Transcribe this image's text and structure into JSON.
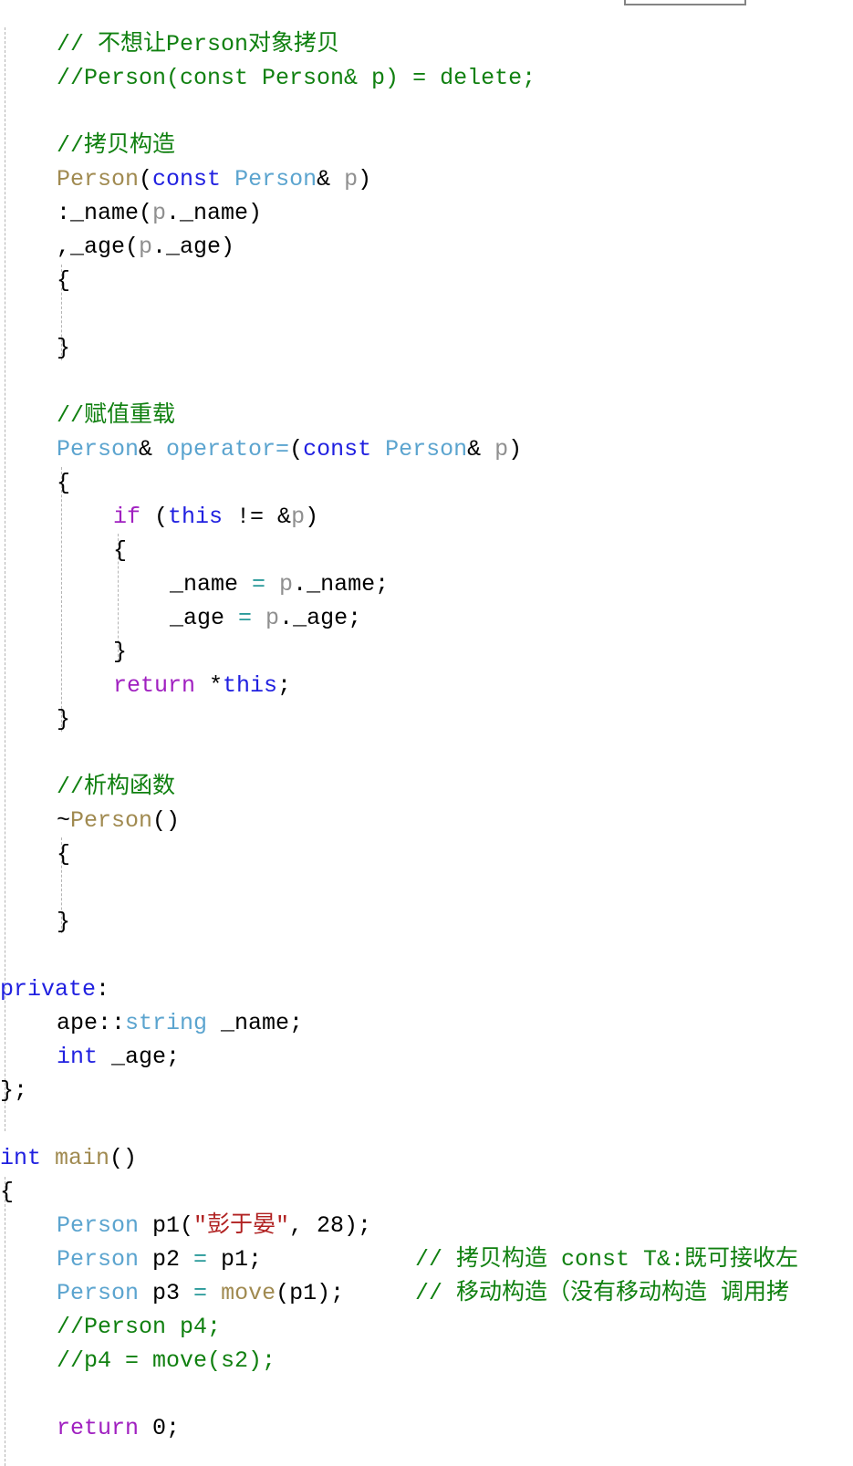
{
  "app": {
    "kind": "code-editor-viewport",
    "language": "C++",
    "background": "#ffffff"
  },
  "colors": {
    "comment": "#108010",
    "keyword": "#2020e0",
    "control_keyword": "#a020c0",
    "type": "#5ba4cf",
    "function": "#a08a50",
    "variable": "#909090",
    "string": "#b02020",
    "operator": "#2a9a9a",
    "plain": "#000000",
    "indent_guide": "#b4b4b4",
    "top_fragment_border": "#848484"
  },
  "top_fragment": {
    "name": "clipped-popup-box"
  },
  "code": {
    "lines": [
      {
        "indent": 1,
        "tokens": [
          {
            "t": "// 不想让Person对象拷贝",
            "c": "cmt"
          }
        ]
      },
      {
        "indent": 1,
        "tokens": [
          {
            "t": "//Person(const Person& p) = delete;",
            "c": "cmt"
          }
        ]
      },
      {
        "indent": 1,
        "tokens": []
      },
      {
        "indent": 1,
        "tokens": [
          {
            "t": "//拷贝构造",
            "c": "cmt"
          }
        ]
      },
      {
        "indent": 1,
        "tokens": [
          {
            "t": "Person",
            "c": "fn"
          },
          {
            "t": "(",
            "c": "pl"
          },
          {
            "t": "const",
            "c": "kw"
          },
          {
            "t": " ",
            "c": "pl"
          },
          {
            "t": "Person",
            "c": "type"
          },
          {
            "t": "& ",
            "c": "pl"
          },
          {
            "t": "p",
            "c": "var"
          },
          {
            "t": ")",
            "c": "pl"
          }
        ]
      },
      {
        "indent": 1,
        "tokens": [
          {
            "t": ":_name(",
            "c": "pl"
          },
          {
            "t": "p",
            "c": "var"
          },
          {
            "t": "._name)",
            "c": "pl"
          }
        ]
      },
      {
        "indent": 1,
        "tokens": [
          {
            "t": ",_age(",
            "c": "pl"
          },
          {
            "t": "p",
            "c": "var"
          },
          {
            "t": "._age)",
            "c": "pl"
          }
        ]
      },
      {
        "indent": 1,
        "tokens": [
          {
            "t": "{",
            "c": "pl"
          }
        ]
      },
      {
        "indent": 2,
        "tokens": []
      },
      {
        "indent": 1,
        "tokens": [
          {
            "t": "}",
            "c": "pl"
          }
        ]
      },
      {
        "indent": 1,
        "tokens": []
      },
      {
        "indent": 1,
        "tokens": [
          {
            "t": "//赋值重载",
            "c": "cmt"
          }
        ]
      },
      {
        "indent": 1,
        "tokens": [
          {
            "t": "Person",
            "c": "type"
          },
          {
            "t": "& ",
            "c": "pl"
          },
          {
            "t": "operator=",
            "c": "type"
          },
          {
            "t": "(",
            "c": "pl"
          },
          {
            "t": "const",
            "c": "kw"
          },
          {
            "t": " ",
            "c": "pl"
          },
          {
            "t": "Person",
            "c": "type"
          },
          {
            "t": "& ",
            "c": "pl"
          },
          {
            "t": "p",
            "c": "var"
          },
          {
            "t": ")",
            "c": "pl"
          }
        ]
      },
      {
        "indent": 1,
        "tokens": [
          {
            "t": "{",
            "c": "pl"
          }
        ]
      },
      {
        "indent": 2,
        "tokens": [
          {
            "t": "if",
            "c": "kwc"
          },
          {
            "t": " (",
            "c": "pl"
          },
          {
            "t": "this",
            "c": "kw"
          },
          {
            "t": " != &",
            "c": "pl"
          },
          {
            "t": "p",
            "c": "var"
          },
          {
            "t": ")",
            "c": "pl"
          }
        ]
      },
      {
        "indent": 2,
        "tokens": [
          {
            "t": "{",
            "c": "pl"
          }
        ]
      },
      {
        "indent": 3,
        "tokens": [
          {
            "t": "_name ",
            "c": "pl"
          },
          {
            "t": "=",
            "c": "op"
          },
          {
            "t": " ",
            "c": "pl"
          },
          {
            "t": "p",
            "c": "var"
          },
          {
            "t": "._name;",
            "c": "pl"
          }
        ]
      },
      {
        "indent": 3,
        "tokens": [
          {
            "t": "_age ",
            "c": "pl"
          },
          {
            "t": "=",
            "c": "op"
          },
          {
            "t": " ",
            "c": "pl"
          },
          {
            "t": "p",
            "c": "var"
          },
          {
            "t": "._age;",
            "c": "pl"
          }
        ]
      },
      {
        "indent": 2,
        "tokens": [
          {
            "t": "}",
            "c": "pl"
          }
        ]
      },
      {
        "indent": 2,
        "tokens": [
          {
            "t": "return",
            "c": "kwc"
          },
          {
            "t": " *",
            "c": "pl"
          },
          {
            "t": "this",
            "c": "kw"
          },
          {
            "t": ";",
            "c": "pl"
          }
        ]
      },
      {
        "indent": 1,
        "tokens": [
          {
            "t": "}",
            "c": "pl"
          }
        ]
      },
      {
        "indent": 1,
        "tokens": []
      },
      {
        "indent": 1,
        "tokens": [
          {
            "t": "//析构函数",
            "c": "cmt"
          }
        ]
      },
      {
        "indent": 1,
        "tokens": [
          {
            "t": "~",
            "c": "pl"
          },
          {
            "t": "Person",
            "c": "fn"
          },
          {
            "t": "()",
            "c": "pl"
          }
        ]
      },
      {
        "indent": 1,
        "tokens": [
          {
            "t": "{",
            "c": "pl"
          }
        ]
      },
      {
        "indent": 2,
        "tokens": []
      },
      {
        "indent": 1,
        "tokens": [
          {
            "t": "}",
            "c": "pl"
          }
        ]
      },
      {
        "indent": 1,
        "tokens": []
      },
      {
        "indent": 0,
        "tokens": [
          {
            "t": "private",
            "c": "kw"
          },
          {
            "t": ":",
            "c": "pl"
          }
        ]
      },
      {
        "indent": 1,
        "tokens": [
          {
            "t": "ape::",
            "c": "pl"
          },
          {
            "t": "string",
            "c": "type"
          },
          {
            "t": " _name;",
            "c": "pl"
          }
        ]
      },
      {
        "indent": 1,
        "tokens": [
          {
            "t": "int",
            "c": "kw"
          },
          {
            "t": " _age;",
            "c": "pl"
          }
        ]
      },
      {
        "indent": 0,
        "tokens": [
          {
            "t": "};",
            "c": "pl"
          }
        ]
      },
      {
        "indent": 0,
        "tokens": []
      },
      {
        "indent": 0,
        "tokens": [
          {
            "t": "int",
            "c": "kw"
          },
          {
            "t": " ",
            "c": "pl"
          },
          {
            "t": "main",
            "c": "fn"
          },
          {
            "t": "()",
            "c": "pl"
          }
        ]
      },
      {
        "indent": 0,
        "tokens": [
          {
            "t": "{",
            "c": "pl"
          }
        ]
      },
      {
        "indent": 1,
        "tokens": [
          {
            "t": "Person",
            "c": "type"
          },
          {
            "t": " p1(",
            "c": "pl"
          },
          {
            "t": "\"彭于晏\"",
            "c": "str"
          },
          {
            "t": ", 28);",
            "c": "pl"
          }
        ]
      },
      {
        "indent": 1,
        "tokens": [
          {
            "t": "Person",
            "c": "type"
          },
          {
            "t": " p2 ",
            "c": "pl"
          },
          {
            "t": "=",
            "c": "op"
          },
          {
            "t": " p1;",
            "c": "pl"
          }
        ],
        "trailing_comment": "// 拷贝构造 const T&:既可接收左"
      },
      {
        "indent": 1,
        "tokens": [
          {
            "t": "Person",
            "c": "type"
          },
          {
            "t": " p3 ",
            "c": "pl"
          },
          {
            "t": "=",
            "c": "op"
          },
          {
            "t": " ",
            "c": "pl"
          },
          {
            "t": "move",
            "c": "fn"
          },
          {
            "t": "(p1);",
            "c": "pl"
          }
        ],
        "trailing_comment": "// 移动构造（没有移动构造 调用拷"
      },
      {
        "indent": 1,
        "tokens": [
          {
            "t": "//Person p4;",
            "c": "cmt"
          }
        ]
      },
      {
        "indent": 1,
        "tokens": [
          {
            "t": "//p4 = move(s2);",
            "c": "cmt"
          }
        ]
      },
      {
        "indent": 1,
        "tokens": []
      },
      {
        "indent": 1,
        "tokens": [
          {
            "t": "return",
            "c": "kwc"
          },
          {
            "t": " 0;",
            "c": "pl"
          }
        ]
      }
    ]
  }
}
